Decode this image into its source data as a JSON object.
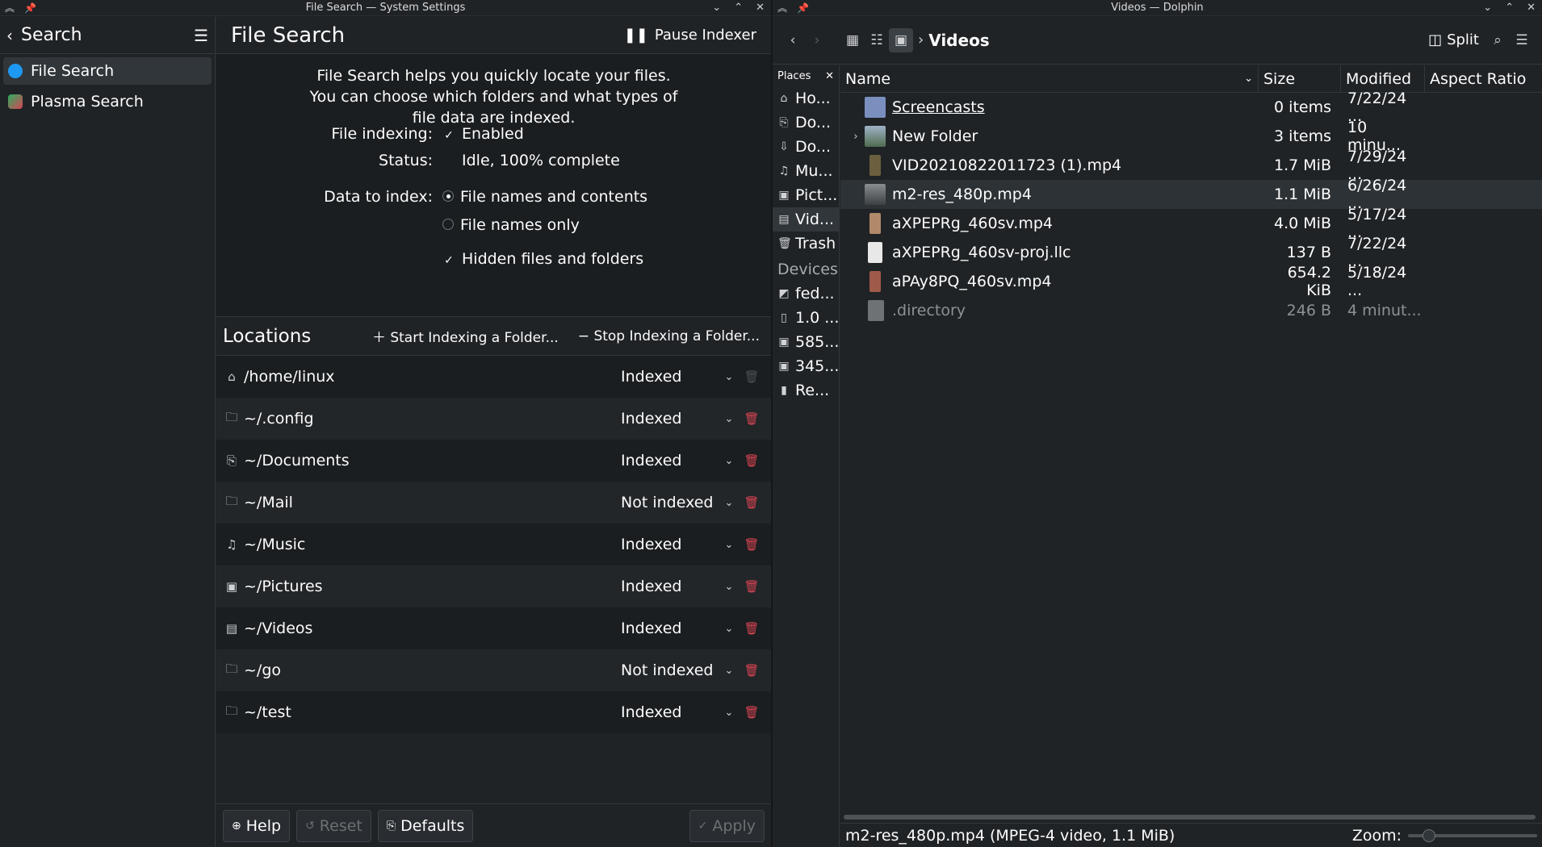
{
  "left_window": {
    "title": "File Search — System Settings",
    "sidebar": {
      "title": "Search",
      "items": [
        {
          "label": "File Search",
          "icon": "file-search-icon",
          "color": "#1d99f3"
        },
        {
          "label": "Plasma Search",
          "icon": "plasma-search-icon",
          "color": "#27ae60"
        }
      ]
    },
    "page_title": "File Search",
    "pause_label": "Pause Indexer",
    "description": [
      "File Search helps you quickly locate your files.",
      "You can choose which folders and what types of",
      "file data are indexed."
    ],
    "file_indexing_label": "File indexing:",
    "file_indexing_value": "Enabled",
    "status_label": "Status:",
    "status_value": "Idle, 100% complete",
    "data_to_index_label": "Data to index:",
    "option_names_contents": "File names and contents",
    "option_names_only": "File names only",
    "option_hidden": "Hidden files and folders",
    "locations_title": "Locations",
    "start_indexing_label": "Start Indexing a Folder...",
    "stop_indexing_label": "Stop Indexing a Folder...",
    "locations": [
      {
        "path": "/home/linux",
        "status": "Indexed",
        "icon": "home-icon"
      },
      {
        "path": "~/.config",
        "status": "Indexed",
        "icon": "folder-icon"
      },
      {
        "path": "~/Documents",
        "status": "Indexed",
        "icon": "documents-icon"
      },
      {
        "path": "~/Mail",
        "status": "Not indexed",
        "icon": "folder-icon"
      },
      {
        "path": "~/Music",
        "status": "Indexed",
        "icon": "music-icon"
      },
      {
        "path": "~/Pictures",
        "status": "Indexed",
        "icon": "pictures-icon"
      },
      {
        "path": "~/Videos",
        "status": "Indexed",
        "icon": "videos-icon"
      },
      {
        "path": "~/go",
        "status": "Not indexed",
        "icon": "folder-icon"
      },
      {
        "path": "~/test",
        "status": "Indexed",
        "icon": "folder-icon"
      }
    ],
    "footer": {
      "help": "Help",
      "reset": "Reset",
      "defaults": "Defaults",
      "apply": "Apply"
    }
  },
  "right_window": {
    "title": "Videos — Dolphin",
    "breadcrumb": "Videos",
    "split_label": "Split",
    "places_title": "Places",
    "places": [
      "Ho...",
      "Do...",
      "Do...",
      "Mu...",
      "Pict...",
      "Vid...",
      "Trash"
    ],
    "devices_title": "Devices",
    "devices": [
      "fed...",
      "1.0 ...",
      "585...",
      "345...",
      "Re..."
    ],
    "columns": {
      "name": "Name",
      "size": "Size",
      "modified": "Modified",
      "aspect": "Aspect Ratio"
    },
    "files": [
      {
        "name": "Screencasts",
        "size": "0 items",
        "modified": "7/22/24 ...",
        "type": "folder"
      },
      {
        "name": "New Folder",
        "size": "3 items",
        "modified": "10 minu...",
        "type": "folder-thumb"
      },
      {
        "name": "VID20210822011723 (1).mp4",
        "size": "1.7 MiB",
        "modified": "7/29/24 ...",
        "type": "video"
      },
      {
        "name": "m2-res_480p.mp4",
        "size": "1.1 MiB",
        "modified": "6/26/24 ...",
        "type": "video"
      },
      {
        "name": "aXPEPRg_460sv.mp4",
        "size": "4.0 MiB",
        "modified": "5/17/24 ...",
        "type": "video"
      },
      {
        "name": "aXPEPRg_460sv-proj.llc",
        "size": "137 B",
        "modified": "7/22/24 ...",
        "type": "doc"
      },
      {
        "name": "aPAy8PQ_460sv.mp4",
        "size": "654.2 KiB",
        "modified": "5/18/24 ...",
        "type": "video"
      },
      {
        "name": ".directory",
        "size": "246 B",
        "modified": "4 minut...",
        "type": "doc"
      }
    ],
    "status_text": "m2-res_480p.mp4 (MPEG-4 video, 1.1 MiB)",
    "zoom_label": "Zoom:"
  }
}
